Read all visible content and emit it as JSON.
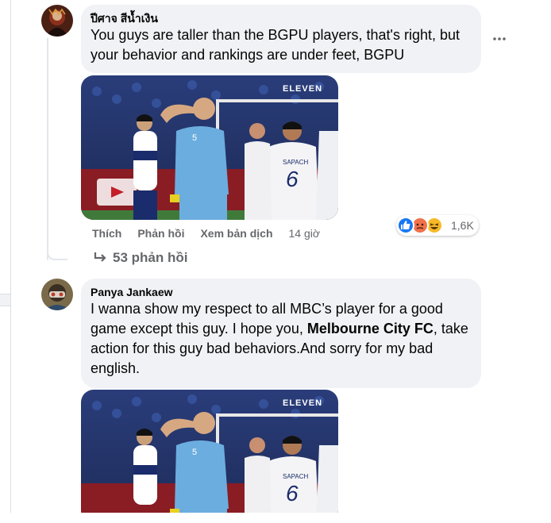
{
  "comments": [
    {
      "author": "ปีศาจ สีน้ำเงิน",
      "text": "You guys are taller than the BGPU players, that's right, but your behavior and rankings are under feet, BGPU",
      "media": {
        "watermark": "ELEVEN",
        "jersey_name": "SAPACH",
        "jersey_number": "6",
        "player_number": "5"
      },
      "actions": {
        "like": "Thích",
        "reply": "Phản hồi",
        "translate": "Xem bản dịch",
        "time": "14 giờ"
      },
      "reactions": {
        "icons": [
          "like-icon",
          "angry-icon",
          "haha-icon"
        ],
        "count": "1,6K"
      },
      "replies_label": "53 phản hồi"
    },
    {
      "author": "Panya Jankaew",
      "text_before": "I wanna show my respect to all MBC’s player for a good game except this guy. I hope you, ",
      "text_bold": "Melbourne City FC",
      "text_after": ", take action for this guy bad behaviors.And sorry for my bad english.",
      "media": {
        "watermark": "ELEVEN",
        "jersey_name": "SAPACH",
        "jersey_number": "6",
        "player_number": "5"
      }
    }
  ],
  "colors": {
    "background": "#f0f2f5",
    "bubble": "#f0f2f5",
    "secondary_text": "#65676b",
    "like_blue": "#1877f2",
    "angry_orange": "#f0714a",
    "haha_yellow": "#f7b928",
    "city_sky_blue": "#6caddf"
  }
}
